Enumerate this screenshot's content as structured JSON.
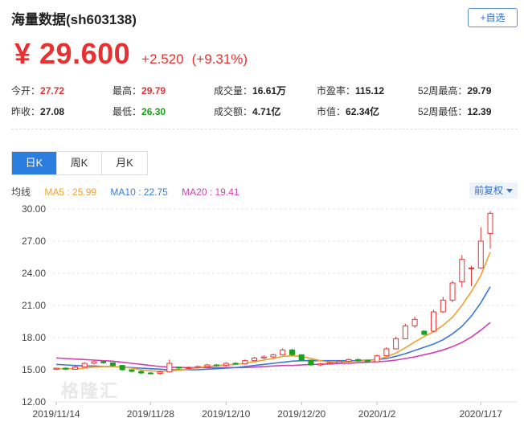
{
  "header": {
    "title": "海量数据(sh603138)",
    "add_label": "+自选"
  },
  "quote": {
    "price": "¥ 29.600",
    "change": "+2.520",
    "change_pct": "(+9.31%)"
  },
  "stats": [
    {
      "label": "今开：",
      "value": "27.72",
      "color": "red"
    },
    {
      "label": "最高：",
      "value": "29.79",
      "color": "red"
    },
    {
      "label": "成交量：",
      "value": "16.61万",
      "color": "plain"
    },
    {
      "label": "市盈率：",
      "value": "115.12",
      "color": "plain"
    },
    {
      "label": "52周最高：",
      "value": "29.79",
      "color": "plain"
    },
    {
      "label": "昨收：",
      "value": "27.08",
      "color": "plain"
    },
    {
      "label": "最低：",
      "value": "26.30",
      "color": "green"
    },
    {
      "label": "成交额：",
      "value": "4.71亿",
      "color": "plain"
    },
    {
      "label": "市值：",
      "value": "62.34亿",
      "color": "plain"
    },
    {
      "label": "52周最低：",
      "value": "12.39",
      "color": "plain"
    }
  ],
  "tabs": [
    {
      "label": "日K",
      "active": true
    },
    {
      "label": "周K",
      "active": false
    },
    {
      "label": "月K",
      "active": false
    }
  ],
  "ma": {
    "label": "均线",
    "ma5": "MA5 : 25.99",
    "ma10": "MA10 : 22.75",
    "ma20": "MA20 : 19.41"
  },
  "adjust_label": "前复权",
  "watermark": "格隆汇",
  "colors": {
    "up": "#e93030",
    "down": "#1aa11a",
    "ma5": "#f0a030",
    "ma10": "#3a78d8",
    "ma20": "#d040b0",
    "accent": "#2c7de0"
  },
  "chart_data": {
    "type": "candlestick",
    "ylim": [
      12.0,
      30.0
    ],
    "y_ticks": [
      "30.00",
      "27.00",
      "24.00",
      "21.00",
      "18.00",
      "15.00",
      "12.00"
    ],
    "x_ticks": [
      {
        "label": "2019/11/14",
        "index": 0
      },
      {
        "label": "2019/11/28",
        "index": 10
      },
      {
        "label": "2019/12/10",
        "index": 18
      },
      {
        "label": "2019/12/20",
        "index": 26
      },
      {
        "label": "2020/1/2",
        "index": 34
      },
      {
        "label": "2020/1/17",
        "index": 45
      }
    ],
    "candles": [
      [
        15.05,
        15.15,
        14.95,
        15.2
      ],
      [
        15.15,
        15.05,
        14.95,
        15.25
      ],
      [
        15.05,
        15.25,
        15.0,
        15.35
      ],
      [
        15.25,
        15.6,
        15.2,
        15.7
      ],
      [
        15.6,
        15.75,
        15.5,
        15.85
      ],
      [
        15.75,
        15.65,
        15.55,
        15.85
      ],
      [
        15.65,
        15.4,
        15.3,
        15.7
      ],
      [
        15.4,
        15.0,
        14.9,
        15.45
      ],
      [
        15.0,
        14.85,
        14.75,
        15.05
      ],
      [
        14.85,
        14.7,
        14.6,
        14.95
      ],
      [
        14.7,
        14.65,
        14.55,
        14.8
      ],
      [
        14.65,
        14.8,
        14.55,
        14.9
      ],
      [
        14.8,
        15.6,
        14.75,
        15.95
      ],
      [
        15.25,
        15.15,
        15.05,
        15.3
      ],
      [
        15.15,
        15.2,
        15.05,
        15.3
      ],
      [
        15.2,
        15.3,
        15.1,
        15.4
      ],
      [
        15.3,
        15.45,
        15.2,
        15.55
      ],
      [
        15.45,
        15.4,
        15.3,
        15.55
      ],
      [
        15.4,
        15.6,
        15.3,
        15.7
      ],
      [
        15.6,
        15.55,
        15.45,
        15.7
      ],
      [
        15.55,
        15.85,
        15.5,
        15.95
      ],
      [
        15.85,
        16.1,
        15.8,
        16.2
      ],
      [
        16.1,
        16.2,
        16.0,
        16.35
      ],
      [
        16.2,
        16.4,
        16.1,
        16.5
      ],
      [
        16.4,
        16.85,
        16.35,
        17.0
      ],
      [
        16.85,
        16.4,
        16.3,
        16.95
      ],
      [
        16.4,
        15.9,
        15.8,
        16.45
      ],
      [
        15.9,
        15.45,
        15.35,
        15.95
      ],
      [
        15.45,
        15.55,
        15.35,
        15.65
      ],
      [
        15.55,
        15.65,
        15.45,
        15.75
      ],
      [
        15.65,
        15.8,
        15.55,
        15.9
      ],
      [
        15.8,
        15.95,
        15.7,
        16.05
      ],
      [
        15.95,
        15.85,
        15.75,
        16.05
      ],
      [
        15.85,
        15.75,
        15.65,
        15.95
      ],
      [
        15.75,
        16.3,
        15.7,
        16.4
      ],
      [
        16.3,
        16.95,
        16.25,
        17.1
      ],
      [
        16.95,
        17.9,
        16.9,
        18.1
      ],
      [
        17.9,
        19.1,
        17.85,
        19.3
      ],
      [
        19.1,
        19.7,
        18.9,
        19.95
      ],
      [
        18.6,
        18.3,
        18.2,
        18.7
      ],
      [
        18.6,
        20.4,
        18.5,
        20.6
      ],
      [
        20.4,
        21.5,
        20.3,
        21.8
      ],
      [
        21.5,
        23.1,
        21.3,
        23.3
      ],
      [
        23.2,
        25.3,
        22.7,
        25.7
      ],
      [
        24.5,
        24.5,
        22.8,
        24.7
      ],
      [
        24.5,
        27.0,
        24.4,
        28.3
      ],
      [
        27.72,
        29.6,
        26.3,
        29.79
      ]
    ],
    "ma5_line": [
      15.1,
      15.1,
      15.1,
      15.15,
      15.25,
      15.3,
      15.3,
      15.25,
      15.15,
      15.0,
      14.9,
      14.85,
      14.9,
      14.95,
      15.05,
      15.2,
      15.3,
      15.4,
      15.45,
      15.5,
      15.6,
      15.75,
      15.9,
      16.05,
      16.25,
      16.3,
      16.25,
      16.05,
      15.85,
      15.7,
      15.7,
      15.75,
      15.8,
      15.85,
      15.95,
      16.2,
      16.55,
      17.05,
      17.6,
      18.1,
      18.55,
      19.15,
      19.9,
      21.0,
      22.3,
      23.8,
      25.99
    ],
    "ma10_line": [
      15.5,
      15.45,
      15.4,
      15.35,
      15.35,
      15.3,
      15.3,
      15.25,
      15.2,
      15.15,
      15.1,
      15.05,
      15.0,
      15.0,
      15.0,
      15.0,
      15.05,
      15.1,
      15.15,
      15.2,
      15.3,
      15.4,
      15.5,
      15.6,
      15.7,
      15.8,
      15.85,
      15.85,
      15.85,
      15.85,
      15.85,
      15.85,
      15.85,
      15.9,
      15.95,
      16.05,
      16.25,
      16.5,
      16.8,
      17.1,
      17.4,
      17.8,
      18.35,
      19.05,
      20.0,
      21.25,
      22.75
    ],
    "ma20_line": [
      16.1,
      16.05,
      16.0,
      15.95,
      15.9,
      15.85,
      15.8,
      15.7,
      15.6,
      15.5,
      15.4,
      15.3,
      15.25,
      15.2,
      15.2,
      15.2,
      15.2,
      15.2,
      15.2,
      15.2,
      15.2,
      15.25,
      15.3,
      15.35,
      15.4,
      15.4,
      15.45,
      15.5,
      15.5,
      15.55,
      15.6,
      15.6,
      15.65,
      15.7,
      15.75,
      15.8,
      15.9,
      16.05,
      16.2,
      16.4,
      16.6,
      16.85,
      17.15,
      17.55,
      18.05,
      18.7,
      19.41
    ]
  }
}
